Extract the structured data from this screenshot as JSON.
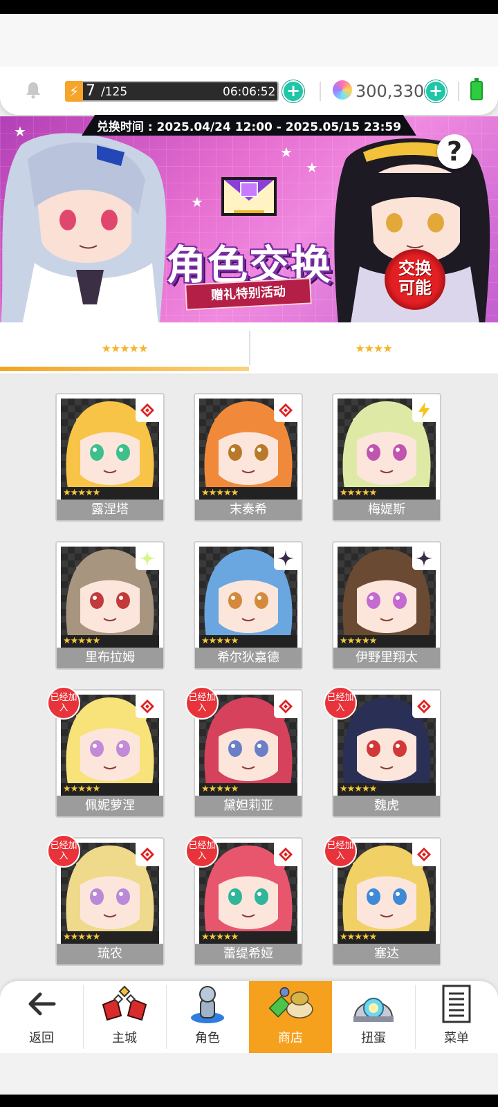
{
  "hud": {
    "stamina_current": "7",
    "stamina_max": "/125",
    "stamina_timer": "06:06:52",
    "gems": "300,330"
  },
  "banner": {
    "period": "兑换时间 : 2025.04/24 12:00 - 2025.05/15 23:59",
    "title": "角色交换",
    "subtitle": "赠礼特别活动",
    "badge": "交换可能",
    "help": "?"
  },
  "tabs": [
    {
      "label": "★★★★★",
      "active": true
    },
    {
      "label": "★★★★",
      "active": false
    }
  ],
  "characters": [
    {
      "name": "露涅塔",
      "stars": "★★★★★",
      "rarity_icon": "diamond-icon",
      "joined": false,
      "hair": "#f7c447",
      "eye": "#3fbf8c"
    },
    {
      "name": "末奏希",
      "stars": "★★★★★",
      "rarity_icon": "diamond-icon",
      "joined": false,
      "hair": "#f08a3a",
      "eye": "#b87a2a"
    },
    {
      "name": "梅媞斯",
      "stars": "★★★★★",
      "rarity_icon": "lightning-icon",
      "joined": false,
      "hair": "#dfe9a6",
      "eye": "#c055b0"
    },
    {
      "name": "里布拉姆",
      "stars": "★★★★★",
      "rarity_icon": "sparkle-icon",
      "joined": false,
      "hair": "#a89580",
      "eye": "#c23a3a"
    },
    {
      "name": "希尔狄嘉德",
      "stars": "★★★★★",
      "rarity_icon": "dark-star-icon",
      "joined": false,
      "hair": "#6aa6e0",
      "eye": "#d48a3a"
    },
    {
      "name": "伊野里翔太",
      "stars": "★★★★★",
      "rarity_icon": "dark-star-icon",
      "joined": false,
      "hair": "#6b4a33",
      "eye": "#c46ad0"
    },
    {
      "name": "佩妮萝涅",
      "stars": "★★★★★",
      "rarity_icon": "diamond-icon",
      "joined": true,
      "hair": "#f8e27a",
      "eye": "#c28ad8"
    },
    {
      "name": "黛妲莉亚",
      "stars": "★★★★★",
      "rarity_icon": "diamond-icon",
      "joined": true,
      "hair": "#d6415c",
      "eye": "#6a7fc8"
    },
    {
      "name": "魏虎",
      "stars": "★★★★★",
      "rarity_icon": "diamond-icon",
      "joined": true,
      "hair": "#2a2f55",
      "eye": "#d23838"
    },
    {
      "name": "琉农",
      "stars": "★★★★★",
      "rarity_icon": "diamond-icon",
      "joined": true,
      "hair": "#efd98a",
      "eye": "#b98ad8"
    },
    {
      "name": "蕾缇希娅",
      "stars": "★★★★★",
      "rarity_icon": "diamond-icon",
      "joined": true,
      "hair": "#e8566e",
      "eye": "#2fb59a"
    },
    {
      "name": "塞达",
      "stars": "★★★★★",
      "rarity_icon": "diamond-icon",
      "joined": true,
      "hair": "#f1d066",
      "eye": "#3f8ad8"
    }
  ],
  "joined_label": "已经加入",
  "nav": [
    {
      "label": "返回",
      "icon": "back-arrow-icon"
    },
    {
      "label": "主城",
      "icon": "castle-icon"
    },
    {
      "label": "角色",
      "icon": "character-icon"
    },
    {
      "label": "商店",
      "icon": "shop-icon",
      "active": true
    },
    {
      "label": "扭蛋",
      "icon": "gacha-icon"
    },
    {
      "label": "菜单",
      "icon": "menu-icon"
    }
  ],
  "colors": {
    "accent": "#f6a11e",
    "plus": "#1fc6a8",
    "joined_badge": "#e8333a"
  }
}
